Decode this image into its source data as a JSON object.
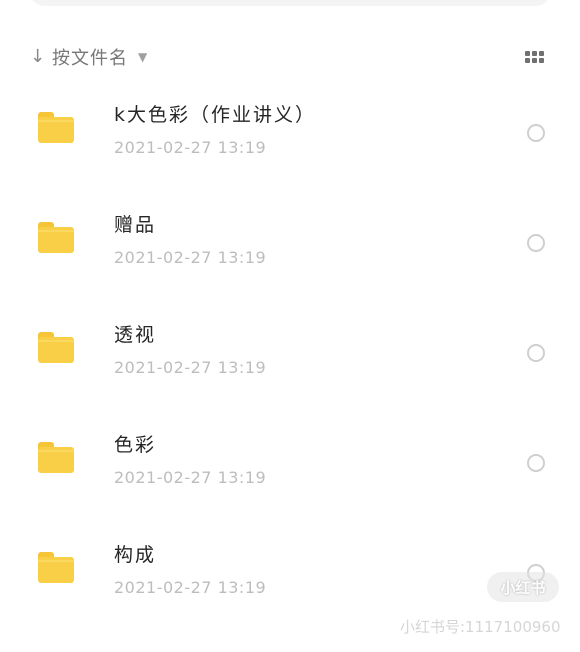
{
  "sort_bar": {
    "arrow_icon": "arrow-down-icon",
    "label": "按文件名",
    "chevron_icon": "chevron-down-icon"
  },
  "view_toggle": {
    "icon": "grid-view-icon"
  },
  "files": [
    {
      "name": "k大色彩（作业讲义）",
      "date": "2021-02-27  13:19",
      "icon": "folder-icon",
      "selected": false
    },
    {
      "name": "赠品",
      "date": "2021-02-27  13:19",
      "icon": "folder-icon",
      "selected": false
    },
    {
      "name": "透视",
      "date": "2021-02-27  13:19",
      "icon": "folder-icon",
      "selected": false
    },
    {
      "name": "色彩",
      "date": "2021-02-27  13:19",
      "icon": "folder-icon",
      "selected": false
    },
    {
      "name": "构成",
      "date": "2021-02-27  13:19",
      "icon": "folder-icon",
      "selected": false
    }
  ],
  "watermark": {
    "badge": "小红书",
    "id_text": "小红书号:1117100960"
  },
  "colors": {
    "folder": "#f9cf48",
    "text_primary": "#262626",
    "text_secondary": "#bdbdbd"
  }
}
